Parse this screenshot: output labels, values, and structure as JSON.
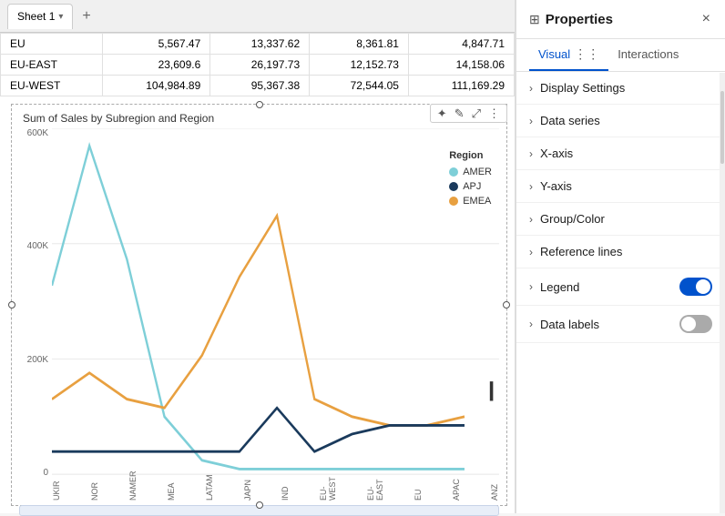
{
  "tab": {
    "name": "Sheet 1",
    "chevron": "▾",
    "add": "+"
  },
  "table": {
    "rows": [
      {
        "label": "EU",
        "col1": "5,567.47",
        "col2": "13,337.62",
        "col3": "8,361.81",
        "col4": "4,847.71"
      },
      {
        "label": "EU-EAST",
        "col1": "23,609.6",
        "col2": "26,197.73",
        "col3": "12,152.73",
        "col4": "14,158.06"
      },
      {
        "label": "EU-WEST",
        "col1": "104,984.89",
        "col2": "95,367.38",
        "col3": "72,544.05",
        "col4": "111,169.29"
      }
    ]
  },
  "chart": {
    "title": "Sum of Sales by Subregion and Region",
    "y_labels": [
      "600K",
      "400K",
      "200K",
      "0"
    ],
    "x_labels": [
      "UKIR",
      "NOR",
      "NAMER",
      "MEA",
      "LATAM",
      "JAPN",
      "IND",
      "EU-WEST",
      "EU-EAST",
      "EU",
      "APAC",
      "ANZ"
    ],
    "legend": {
      "title": "Region",
      "items": [
        {
          "label": "AMER",
          "color": "#7ecfd8"
        },
        {
          "label": "APJ",
          "color": "#1a3a5c"
        },
        {
          "label": "EMEA",
          "color": "#e8a040"
        }
      ]
    }
  },
  "toolbar_buttons": [
    "✦",
    "✎",
    "⤢",
    "⋮"
  ],
  "properties": {
    "title": "Properties",
    "icon": "⊞",
    "close_label": "×",
    "tabs": [
      {
        "label": "Visual",
        "active": true
      },
      {
        "label": "⋮⋮⋮",
        "active": false
      },
      {
        "label": "Interactions",
        "active": false
      }
    ],
    "items": [
      {
        "label": "Display Settings",
        "hasToggle": false
      },
      {
        "label": "Data series",
        "hasToggle": false
      },
      {
        "label": "X-axis",
        "hasToggle": false
      },
      {
        "label": "Y-axis",
        "hasToggle": false
      },
      {
        "label": "Group/Color",
        "hasToggle": false
      },
      {
        "label": "Reference lines",
        "hasToggle": false
      },
      {
        "label": "Legend",
        "hasToggle": true,
        "toggleOn": true
      },
      {
        "label": "Data labels",
        "hasToggle": true,
        "toggleOn": false
      }
    ]
  }
}
